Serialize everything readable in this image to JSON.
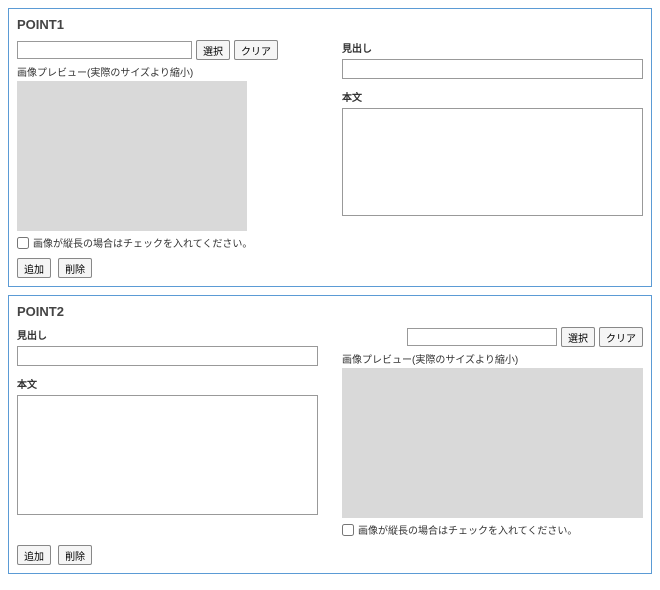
{
  "common": {
    "btn_select": "選択",
    "btn_clear": "クリア",
    "btn_add": "追加",
    "btn_remove": "削除",
    "preview_label": "画像プレビュー(実際のサイズより縮小)",
    "portrait_checkbox": "画像が縦長の場合はチェックを入れてください。",
    "heading_label": "見出し",
    "body_label": "本文"
  },
  "points": [
    {
      "title": "POINT1",
      "path": "",
      "heading": "",
      "body": "",
      "portrait": false,
      "image_left": true
    },
    {
      "title": "POINT2",
      "path": "",
      "heading": "",
      "body": "",
      "portrait": false,
      "image_left": false
    }
  ]
}
